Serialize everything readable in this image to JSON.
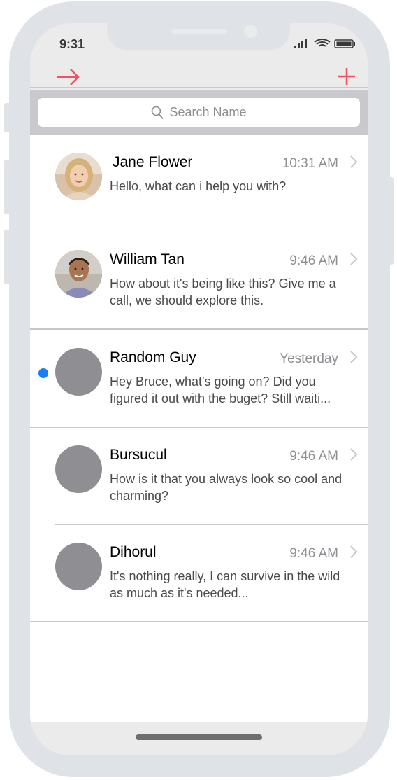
{
  "status_bar": {
    "time": "9:31"
  },
  "nav": {
    "back_icon": "arrow-right-icon",
    "add_icon": "plus-icon",
    "accent_color": "#ef5361"
  },
  "search": {
    "placeholder": "Search Name"
  },
  "conversations": [
    {
      "name": "Jane Flower",
      "time": "10:31 AM",
      "preview": "Hello, what can i help you with?",
      "unread": false,
      "avatar": "photo"
    },
    {
      "name": "William Tan",
      "time": "9:46 AM",
      "preview": "How about it's being like this? Give me a call, we should explore this.",
      "unread": false,
      "avatar": "photo"
    },
    {
      "name": "Random Guy",
      "time": "Yesterday",
      "preview": "Hey Bruce, what's going on? Did you figured it out with the buget? Still waiti...",
      "unread": true,
      "avatar": "placeholder"
    },
    {
      "name": "Bursucul",
      "time": "9:46 AM",
      "preview": "How is it that you always look so cool and charming?",
      "unread": false,
      "avatar": "placeholder"
    },
    {
      "name": "Dihorul",
      "time": "9:46 AM",
      "preview": "It's nothing really, I can survive in the wild as much as it's needed...",
      "unread": false,
      "avatar": "placeholder"
    }
  ],
  "colors": {
    "unread_dot": "#1a7ff0",
    "placeholder_avatar": "#8e8e93"
  }
}
